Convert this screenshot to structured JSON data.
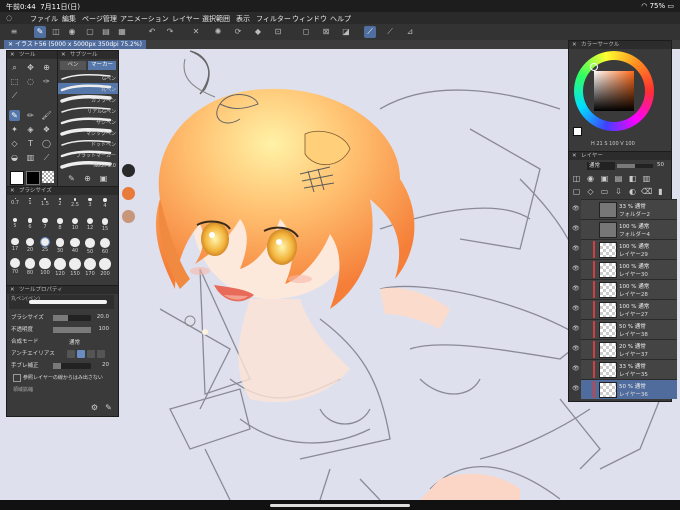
{
  "status": {
    "time": "午前0:44",
    "date": "7月11日(日)",
    "battery": "75%"
  },
  "menu": [
    "ファイル",
    "編集",
    "ページ管理",
    "アニメーション",
    "レイヤー",
    "選択範囲",
    "表示",
    "フィルター",
    "ウィンドウ",
    "ヘルプ"
  ],
  "doc_tab": "イラスト56 (5000 x 5000px 350dpi 75.2%)",
  "tool_panel": {
    "title": "ツール"
  },
  "subtool_panel": {
    "title": "サブツール",
    "tabs": [
      "ペン",
      "マーカー"
    ],
    "brushes": [
      "Gペン",
      "丸ペン",
      "カブラペン",
      "リアルGペン",
      "サジペン",
      "マジックペン",
      "ドットペン",
      "フラットマーカー",
      "Neon 2.0"
    ]
  },
  "brush_size": {
    "title": "ブラシサイズ",
    "sizes": [
      "0.7",
      "1",
      "1.5",
      "2",
      "2.5",
      "3",
      "4",
      "5",
      "6",
      "7",
      "8",
      "10",
      "12",
      "15",
      "17",
      "20",
      "25",
      "30",
      "40",
      "50",
      "60",
      "70",
      "80",
      "100",
      "120",
      "150",
      "170",
      "200"
    ]
  },
  "tool_property": {
    "title": "ツールプロパティ",
    "brush_name": "丸ペン(ペン)",
    "brush_size_label": "ブラシサイズ",
    "brush_size_value": "20.0",
    "opacity_label": "不透明度",
    "opacity_value": "100",
    "blend_label": "合成モード",
    "blend_value": "通常",
    "aa_label": "アンチエイリアス",
    "stabilize_label": "手ブレ補正",
    "stabilize_value": "20",
    "ref_label": "参照レイヤーの線からはみ出さない",
    "region_label": "領域拡縮"
  },
  "color_circle": {
    "title": "カラーサークル",
    "values": [
      "21",
      "100",
      "100"
    ]
  },
  "layer_panel": {
    "title": "レイヤー",
    "blend": "通常",
    "opacity": "50",
    "layers": [
      {
        "pct": "33 % 通常",
        "name": "フォルダー2",
        "kind": "folder"
      },
      {
        "pct": "100 % 通常",
        "name": "フォルダー4",
        "kind": "folder"
      },
      {
        "pct": "100 % 通常",
        "name": "レイヤー29",
        "kind": "layer"
      },
      {
        "pct": "100 % 通常",
        "name": "レイヤー30",
        "kind": "layer"
      },
      {
        "pct": "100 % 通常",
        "name": "レイヤー28",
        "kind": "layer"
      },
      {
        "pct": "100 % 通常",
        "name": "レイヤー27",
        "kind": "layer"
      },
      {
        "pct": "50 % 通常",
        "name": "レイヤー38",
        "kind": "layer"
      },
      {
        "pct": "20 % 通常",
        "name": "レイヤー37",
        "kind": "layer"
      },
      {
        "pct": "33 % 通常",
        "name": "レイヤー35",
        "kind": "layer"
      },
      {
        "pct": "50 % 通常",
        "name": "レイヤー36",
        "kind": "layer"
      }
    ]
  },
  "palette_colors": [
    "#2a2a2a",
    "#e87a3a",
    "#c8967a"
  ]
}
